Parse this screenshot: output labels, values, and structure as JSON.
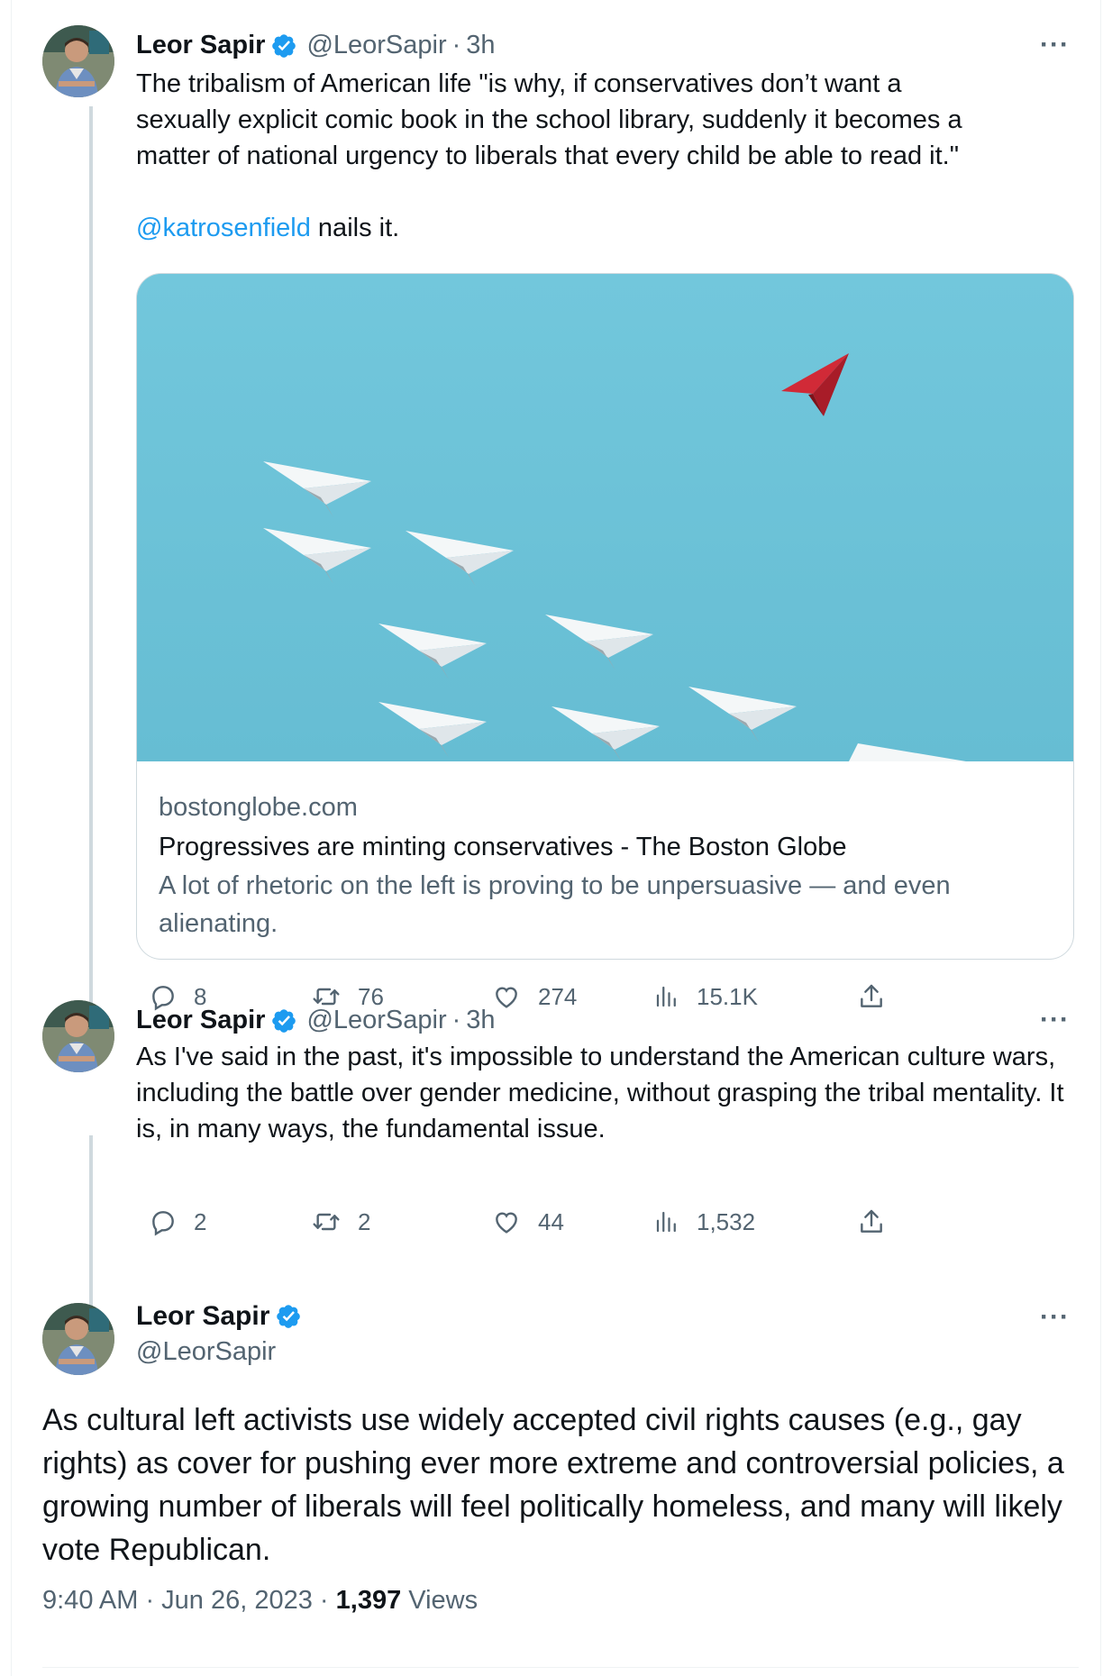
{
  "tweets": [
    {
      "author_name": "Leor Sapir",
      "handle": "@LeorSapir",
      "separator": "·",
      "time": "3h",
      "more": "···",
      "text_parts": [
        "The tribalism of American life \"is why, if conservatives don’t want a",
        "sexually explicit comic book in the school library, suddenly it becomes a",
        "matter of national urgency to liberals that every child be able to read it.\""
      ],
      "mention": "@katrosenfield",
      "mention_suffix": " nails it.",
      "link_card": {
        "domain": "bostonglobe.com",
        "title": "Progressives are minting conservatives - The Boston Globe",
        "description": "A lot of rhetoric on the left is proving to be unpersuasive — and even alienating."
      },
      "stats": {
        "replies": "8",
        "retweets": "76",
        "likes": "274",
        "views": "15.1K"
      }
    },
    {
      "author_name": "Leor Sapir",
      "handle": "@LeorSapir",
      "separator": "·",
      "time": "3h",
      "more": "···",
      "text": "As I've said in the past, it's impossible to understand the American culture wars, including the battle over gender medicine, without grasping the tribal mentality. It is, in many ways, the fundamental issue.",
      "stats": {
        "replies": "2",
        "retweets": "2",
        "likes": "44",
        "views": "1,532"
      }
    }
  ],
  "main_tweet": {
    "author_name": "Leor Sapir",
    "handle": "@LeorSapir",
    "more": "···",
    "text": "As cultural left activists use widely accepted civil rights causes (e.g., gay rights) as cover for pushing ever more extreme and controversial policies, a growing number of liberals will feel politically homeless, and many will likely vote Republican.",
    "timestamp": "9:40 AM · Jun 26, 2023 · ",
    "views_count": "1,397",
    "views_label": " Views"
  },
  "colors": {
    "accent": "#1d9bf0",
    "muted": "#536471",
    "text": "#0f1419",
    "thread_line": "#cfd9de",
    "sky": "#6ec4d8",
    "red_plane": "#c8202f"
  },
  "icons": [
    "verified-badge-icon",
    "more-icon",
    "reply-icon",
    "retweet-icon",
    "like-icon",
    "views-icon",
    "share-icon"
  ]
}
